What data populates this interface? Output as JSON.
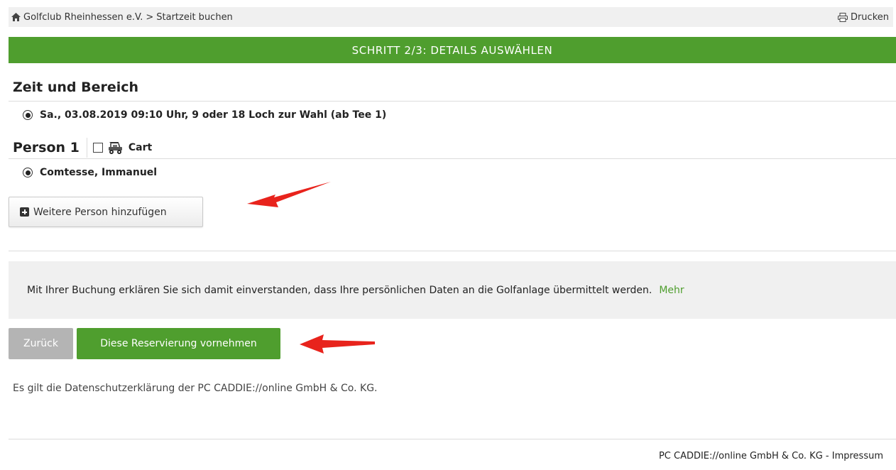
{
  "breadcrumb": {
    "club": "Golfclub Rheinhessen e.V.",
    "separator": ">",
    "page": "Startzeit buchen"
  },
  "print_label": "Drucken",
  "step_title": "SCHRITT 2/3: DETAILS AUSWÄHLEN",
  "section_title": "Zeit und Bereich",
  "time_option": "Sa.,  03.08.2019 09:10 Uhr, 9 oder 18 Loch zur Wahl (ab Tee 1)",
  "person": {
    "label": "Person 1",
    "cart_label": "Cart",
    "cart_checked": false,
    "name": "Comtesse, Immanuel"
  },
  "add_person_label": "Weitere Person hinzufügen",
  "consent": {
    "text": "Mit Ihrer Buchung erklären Sie sich damit einverstanden, dass Ihre persönlichen Daten an die Golfanlage übermittelt werden.",
    "more_link": "Mehr"
  },
  "buttons": {
    "back": "Zurück",
    "reserve": "Diese Reservierung vornehmen"
  },
  "privacy_text": "Es gilt die Datenschutzerklärung der PC CADDIE://online GmbH & Co. KG.",
  "footer_text": "PC CADDIE://online GmbH & Co. KG - Impressum",
  "colors": {
    "brand_green": "#4f9e2e",
    "annotation_red": "#e8231c",
    "button_gray": "#b4b4b4"
  }
}
